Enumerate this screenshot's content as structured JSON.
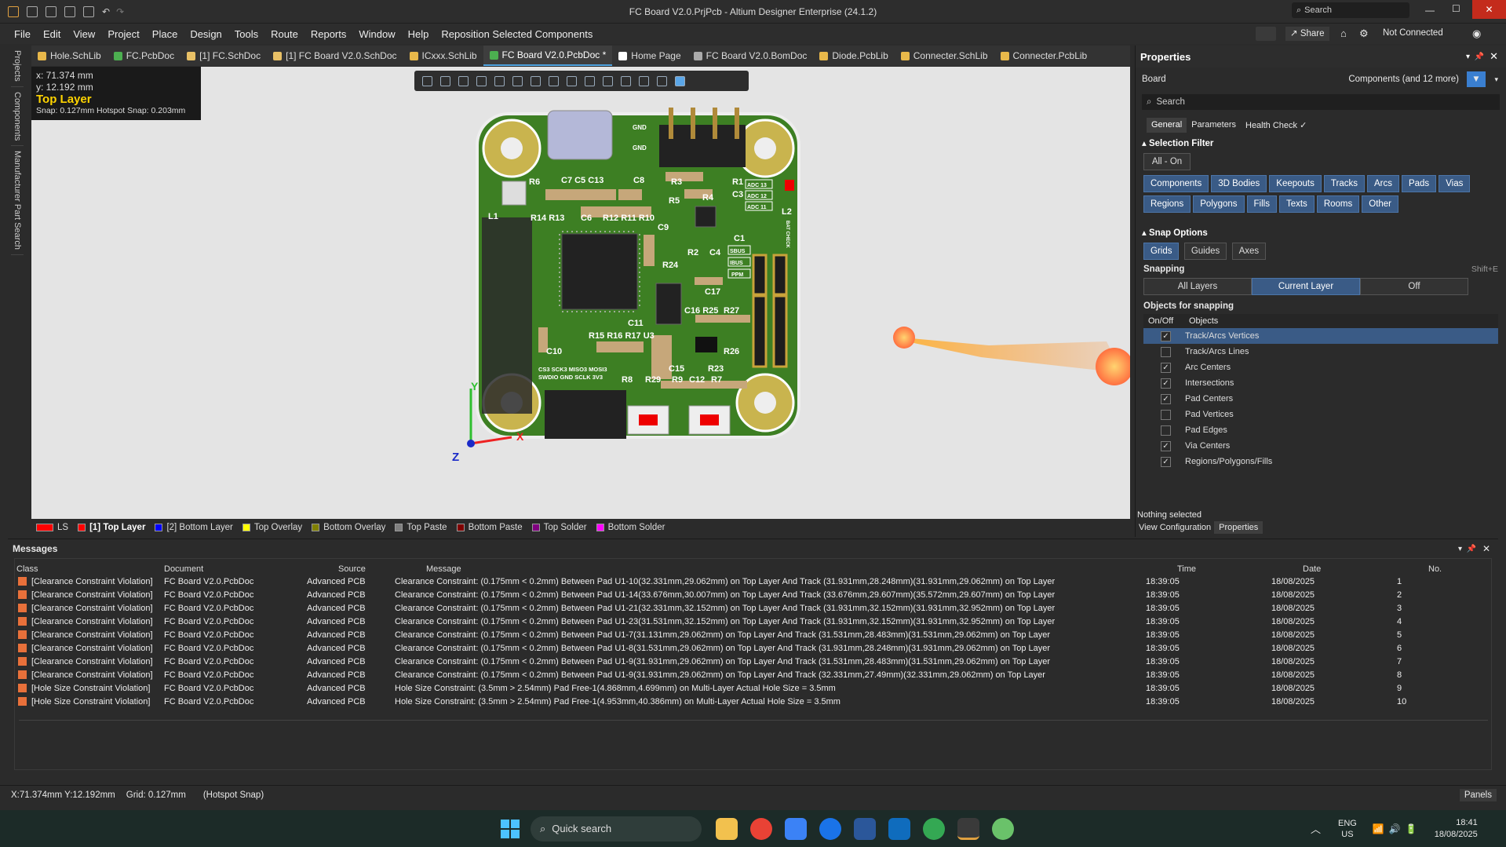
{
  "window": {
    "title": "FC Board V2.0.PrjPcb - Altium Designer Enterprise (24.1.2)",
    "search_placeholder": "Search"
  },
  "menu": [
    "File",
    "Edit",
    "View",
    "Project",
    "Place",
    "Design",
    "Tools",
    "Route",
    "Reports",
    "Window",
    "Help",
    "Reposition Selected Components"
  ],
  "topright": {
    "share": "Share",
    "connection": "Not Connected"
  },
  "doc_tabs": [
    {
      "label": "Hole.SchLib",
      "color": "#e8b84a"
    },
    {
      "label": "FC.PcbDoc",
      "color": "#4caf50"
    },
    {
      "label": "[1] FC.SchDoc",
      "color": "#e8c066"
    },
    {
      "label": "[1] FC Board V2.0.SchDoc",
      "color": "#e8c066"
    },
    {
      "label": "ICxxx.SchLib",
      "color": "#e8b84a"
    },
    {
      "label": "FC Board V2.0.PcbDoc *",
      "color": "#4caf50",
      "active": true
    },
    {
      "label": "Home Page",
      "color": "#ffffff"
    },
    {
      "label": "FC Board V2.0.BomDoc",
      "color": "#aaaaaa"
    },
    {
      "label": "Diode.PcbLib",
      "color": "#e8b84a"
    },
    {
      "label": "Connecter.SchLib",
      "color": "#e8b84a"
    },
    {
      "label": "Connecter.PcbLib",
      "color": "#e8b84a"
    }
  ],
  "left_rail": [
    "Projects",
    "Components",
    "Manufacturer Part Search"
  ],
  "coords": {
    "x": "x: 71.374 mm",
    "y": "y: 12.192 mm",
    "layer": "Top Layer",
    "snap": "Snap: 0.127mm Hotspot Snap: 0.203mm"
  },
  "pcb_labels": {
    "gnd1": "GND",
    "gnd2": "GND",
    "r6": "R6",
    "c7c5c13": "C7 C5 C13",
    "c8": "C8",
    "r3": "R3",
    "r1": "R1",
    "r4": "R4",
    "c3": "C3",
    "r5": "R5",
    "adc13": "ADC 13",
    "adc12": "ADC 12",
    "adc11": "ADC 11",
    "l2": "L2",
    "l1": "L1",
    "r14r13": "R14 R13",
    "c6": "C6",
    "r12r11r10": "R12 R11 R10",
    "c9": "C9",
    "c1": "C1",
    "r2": "R2",
    "c4": "C4",
    "r24": "R24",
    "sbus": "SBUS",
    "ibus": "IBUS",
    "ppm": "PPM",
    "c17": "C17",
    "c16": "C16 R25",
    "r27": "R27",
    "c11": "C11",
    "c10": "C10",
    "r15": "R15 R16 R17 U3",
    "r26": "R26",
    "c15": "C15",
    "r23": "R23",
    "pins1": "CS3  SCK3 MISO3 MOSI3",
    "pins2": "SWDIO GND  SCLK   3V3",
    "r8": "R8",
    "r29": "R29",
    "r9": "R9",
    "c12": "C12",
    "r7": "R7",
    "bat": "BAT CHECK",
    "axis_y": "Y",
    "axis_x": "X",
    "axis_z": "Z"
  },
  "layers": [
    {
      "label": "LS",
      "color": "#ff0000"
    },
    {
      "label": "[1] Top Layer",
      "color": "#ff0000",
      "active": true
    },
    {
      "label": "[2] Bottom Layer",
      "color": "#0000ff"
    },
    {
      "label": "Top Overlay",
      "color": "#ffff00"
    },
    {
      "label": "Bottom Overlay",
      "color": "#808000"
    },
    {
      "label": "Top Paste",
      "color": "#808080"
    },
    {
      "label": "Bottom Paste",
      "color": "#800000"
    },
    {
      "label": "Top Solder",
      "color": "#800080"
    },
    {
      "label": "Bottom Solder",
      "color": "#ff00ff"
    }
  ],
  "properties": {
    "title": "Properties",
    "board_label": "Board",
    "scope": "Components (and 12 more)",
    "search_placeholder": "Search",
    "tabs": [
      "General",
      "Parameters",
      "Health Check ✓"
    ],
    "selection_filter_title": "Selection Filter",
    "all_on": "All - On",
    "filters": [
      "Components",
      "3D Bodies",
      "Keepouts",
      "Tracks",
      "Arcs",
      "Pads",
      "Vias",
      "Regions",
      "Polygons",
      "Fills",
      "Texts",
      "Rooms",
      "Other"
    ],
    "snap_options_title": "Snap Options",
    "snap_buttons": [
      "Grids",
      "Guides",
      "Axes"
    ],
    "snapping_label": "Snapping",
    "snapping_shortcut": "Shift+E",
    "snapping_modes": [
      "All Layers",
      "Current Layer",
      "Off"
    ],
    "objects_title": "Objects for snapping",
    "obj_headers": [
      "On/Off",
      "Objects"
    ],
    "objects": [
      {
        "label": "Track/Arcs Vertices",
        "checked": true,
        "selected": true
      },
      {
        "label": "Track/Arcs Lines",
        "checked": false
      },
      {
        "label": "Arc Centers",
        "checked": true
      },
      {
        "label": "Intersections",
        "checked": true
      },
      {
        "label": "Pad Centers",
        "checked": true
      },
      {
        "label": "Pad Vertices",
        "checked": false
      },
      {
        "label": "Pad Edges",
        "checked": false
      },
      {
        "label": "Via Centers",
        "checked": true
      },
      {
        "label": "Regions/Polygons/Fills",
        "checked": true
      }
    ],
    "nothing_selected": "Nothing selected",
    "bottom_tabs": [
      "View Configuration",
      "Properties"
    ]
  },
  "messages": {
    "title": "Messages",
    "headers": [
      "Class",
      "Document",
      "Source",
      "Message",
      "Time",
      "Date",
      "No."
    ],
    "rows": [
      [
        "[Clearance Constraint Violation]",
        "FC Board V2.0.PcbDoc",
        "Advanced PCB",
        "Clearance Constraint: (0.175mm < 0.2mm) Between Pad U1-10(32.331mm,29.062mm) on Top Layer And Track (31.931mm,28.248mm)(31.931mm,29.062mm) on Top Layer",
        "18:39:05",
        "18/08/2025",
        "1"
      ],
      [
        "[Clearance Constraint Violation]",
        "FC Board V2.0.PcbDoc",
        "Advanced PCB",
        "Clearance Constraint: (0.175mm < 0.2mm) Between Pad U1-14(33.676mm,30.007mm) on Top Layer And Track (33.676mm,29.607mm)(35.572mm,29.607mm) on Top Layer",
        "18:39:05",
        "18/08/2025",
        "2"
      ],
      [
        "[Clearance Constraint Violation]",
        "FC Board V2.0.PcbDoc",
        "Advanced PCB",
        "Clearance Constraint: (0.175mm < 0.2mm) Between Pad U1-21(32.331mm,32.152mm) on Top Layer And Track (31.931mm,32.152mm)(31.931mm,32.952mm) on Top Layer",
        "18:39:05",
        "18/08/2025",
        "3"
      ],
      [
        "[Clearance Constraint Violation]",
        "FC Board V2.0.PcbDoc",
        "Advanced PCB",
        "Clearance Constraint: (0.175mm < 0.2mm) Between Pad U1-23(31.531mm,32.152mm) on Top Layer And Track (31.931mm,32.152mm)(31.931mm,32.952mm) on Top Layer",
        "18:39:05",
        "18/08/2025",
        "4"
      ],
      [
        "[Clearance Constraint Violation]",
        "FC Board V2.0.PcbDoc",
        "Advanced PCB",
        "Clearance Constraint: (0.175mm < 0.2mm) Between Pad U1-7(31.131mm,29.062mm) on Top Layer And Track (31.531mm,28.483mm)(31.531mm,29.062mm) on Top Layer",
        "18:39:05",
        "18/08/2025",
        "5"
      ],
      [
        "[Clearance Constraint Violation]",
        "FC Board V2.0.PcbDoc",
        "Advanced PCB",
        "Clearance Constraint: (0.175mm < 0.2mm) Between Pad U1-8(31.531mm,29.062mm) on Top Layer And Track (31.931mm,28.248mm)(31.931mm,29.062mm) on Top Layer",
        "18:39:05",
        "18/08/2025",
        "6"
      ],
      [
        "[Clearance Constraint Violation]",
        "FC Board V2.0.PcbDoc",
        "Advanced PCB",
        "Clearance Constraint: (0.175mm < 0.2mm) Between Pad U1-9(31.931mm,29.062mm) on Top Layer And Track (31.531mm,28.483mm)(31.531mm,29.062mm) on Top Layer",
        "18:39:05",
        "18/08/2025",
        "7"
      ],
      [
        "[Clearance Constraint Violation]",
        "FC Board V2.0.PcbDoc",
        "Advanced PCB",
        "Clearance Constraint: (0.175mm < 0.2mm) Between Pad U1-9(31.931mm,29.062mm) on Top Layer And Track (32.331mm,27.49mm)(32.331mm,29.062mm) on Top Layer",
        "18:39:05",
        "18/08/2025",
        "8"
      ],
      [
        "[Hole Size Constraint Violation]",
        "FC Board V2.0.PcbDoc",
        "Advanced PCB",
        "Hole Size Constraint: (3.5mm > 2.54mm) Pad Free-1(4.868mm,4.699mm) on Multi-Layer Actual Hole Size = 3.5mm",
        "18:39:05",
        "18/08/2025",
        "9"
      ],
      [
        "[Hole Size Constraint Violation]",
        "FC Board V2.0.PcbDoc",
        "Advanced PCB",
        "Hole Size Constraint: (3.5mm > 2.54mm) Pad Free-1(4.953mm,40.386mm) on Multi-Layer Actual Hole Size = 3.5mm",
        "18:39:05",
        "18/08/2025",
        "10"
      ]
    ]
  },
  "status": {
    "coords": "X:71.374mm Y:12.192mm",
    "grid": "Grid: 0.127mm",
    "snap": "(Hotspot Snap)",
    "panels": "Panels"
  },
  "taskbar": {
    "search": "Quick search",
    "lang1": "ENG",
    "lang2": "US",
    "time": "18:41",
    "date": "18/08/2025"
  }
}
